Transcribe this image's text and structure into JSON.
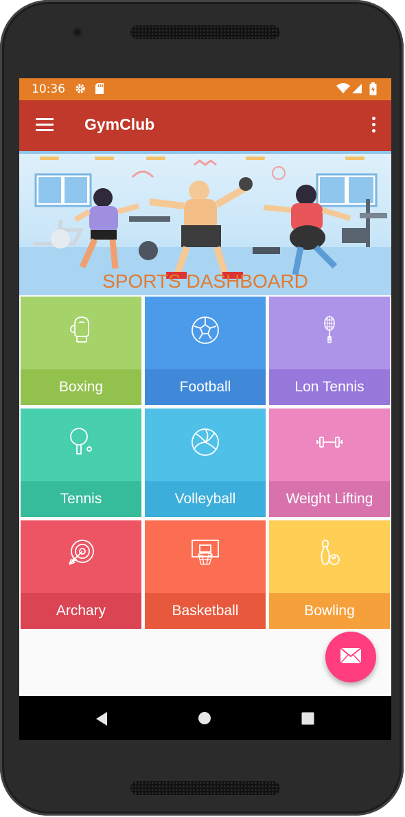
{
  "status_bar": {
    "time": "10:36",
    "icons": [
      "gear-icon",
      "sd-card-icon",
      "wifi-icon",
      "signal-icon",
      "battery-icon"
    ],
    "color": "#e47d25"
  },
  "app_bar": {
    "title": "GymClub",
    "color": "#c0392b"
  },
  "banner": {
    "title": "SPORTS DASHBOARD",
    "title_color": "#e07b30"
  },
  "tiles": [
    {
      "label": "Boxing",
      "icon": "boxing-glove-icon",
      "top_color": "#a5d36a",
      "band_color": "#93c14e"
    },
    {
      "label": "Football",
      "icon": "football-icon",
      "top_color": "#4b9bea",
      "band_color": "#3f89d8"
    },
    {
      "label": "Lon Tennis",
      "icon": "tennis-racket-icon",
      "top_color": "#ad94e8",
      "band_color": "#9778db"
    },
    {
      "label": "Tennis",
      "icon": "table-tennis-icon",
      "top_color": "#48cfad",
      "band_color": "#37bc9b"
    },
    {
      "label": "Volleyball",
      "icon": "volleyball-icon",
      "top_color": "#4fc0e8",
      "band_color": "#3caedb"
    },
    {
      "label": "Weight Lifting",
      "icon": "dumbbell-icon",
      "top_color": "#ec87c0",
      "band_color": "#d772ad"
    },
    {
      "label": "Archary",
      "icon": "archery-target-icon",
      "top_color": "#ed5565",
      "band_color": "#da4453"
    },
    {
      "label": "Basketball",
      "icon": "basketball-hoop-icon",
      "top_color": "#fc6e51",
      "band_color": "#e8583d"
    },
    {
      "label": "Bowling",
      "icon": "bowling-icon",
      "top_color": "#ffce54",
      "band_color": "#f6a03c"
    }
  ],
  "fab": {
    "icon": "mail-icon",
    "color": "#ff3d7f"
  },
  "nav_bar": {
    "icons": [
      "back-icon",
      "home-icon",
      "recents-icon"
    ]
  }
}
